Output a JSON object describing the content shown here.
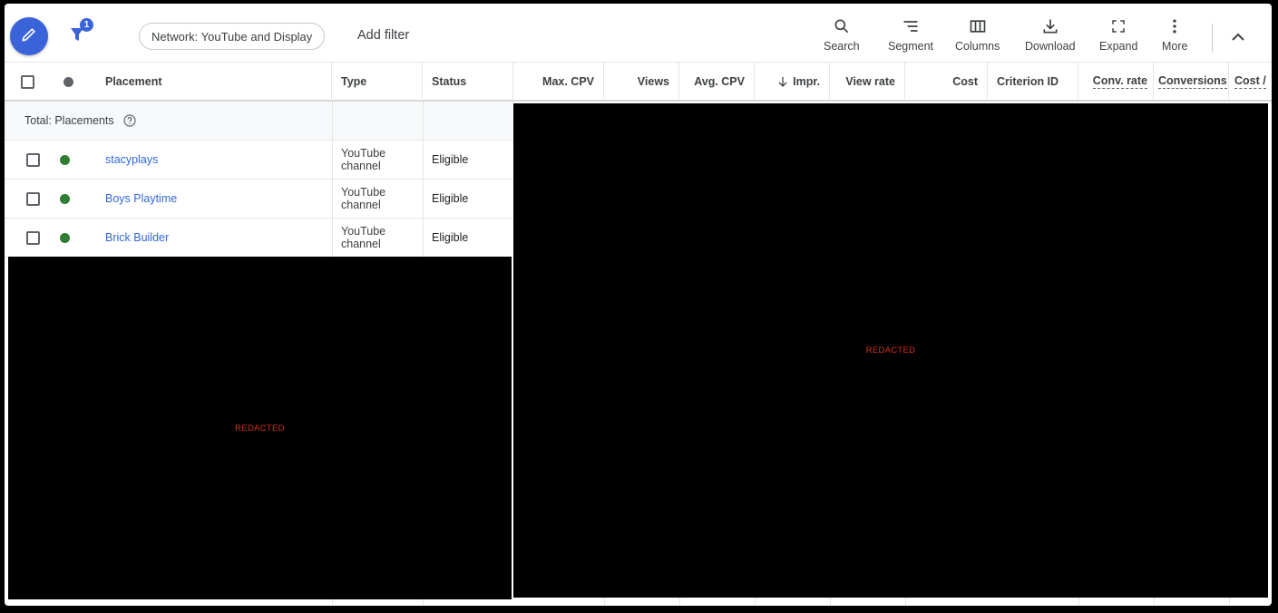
{
  "toolbar": {
    "edit_button": "edit",
    "filter_count": "1",
    "active_filter_chip": "Network: YouTube and Display",
    "add_filter": "Add filter",
    "tools": [
      {
        "label": "Search",
        "icon": "search-icon"
      },
      {
        "label": "Segment",
        "icon": "segment-icon"
      },
      {
        "label": "Columns",
        "icon": "columns-icon"
      },
      {
        "label": "Download",
        "icon": "download-icon"
      },
      {
        "label": "Expand",
        "icon": "expand-icon"
      },
      {
        "label": "More",
        "icon": "more-vert-icon"
      }
    ],
    "collapse_icon": "chevron-up-icon"
  },
  "table": {
    "columns": [
      {
        "label": "Placement"
      },
      {
        "label": "Type"
      },
      {
        "label": "Status"
      },
      {
        "label": "Max. CPV"
      },
      {
        "label": "Views"
      },
      {
        "label": "Avg. CPV"
      },
      {
        "label": "Impr.",
        "sort": "descending"
      },
      {
        "label": "View rate"
      },
      {
        "label": ""
      },
      {
        "label": "Cost"
      },
      {
        "label": "Criterion ID"
      },
      {
        "label": "Conv. rate"
      },
      {
        "label": "Conversions"
      },
      {
        "label": "Cost /"
      }
    ],
    "total_row": {
      "label": "Total: Placements",
      "help_icon": "help-icon"
    },
    "rows": [
      {
        "placement": "stacyplays",
        "type": "YouTube channel",
        "type_line1": "YouTube",
        "type_line2": "channel",
        "status": "Eligible",
        "status_color": "#2e7d32"
      },
      {
        "placement": "Boys Playtime",
        "type": "YouTube channel",
        "type_line1": "YouTube",
        "type_line2": "channel",
        "status": "Eligible",
        "status_color": "#2e7d32"
      },
      {
        "placement": "Brick Builder",
        "type": "YouTube channel",
        "type_line1": "YouTube",
        "type_line2": "channel",
        "status": "Eligible",
        "status_color": "#2e7d32"
      }
    ],
    "header_status_dot_color": "#5f6368"
  },
  "redactions": {
    "left_label": "REDACTED",
    "right_label": "REDACTED"
  },
  "colors": {
    "accent": "#3b63d9",
    "link": "#3367d6",
    "status_eligible": "#2e7d32",
    "redacted_text": "#d7301f"
  }
}
